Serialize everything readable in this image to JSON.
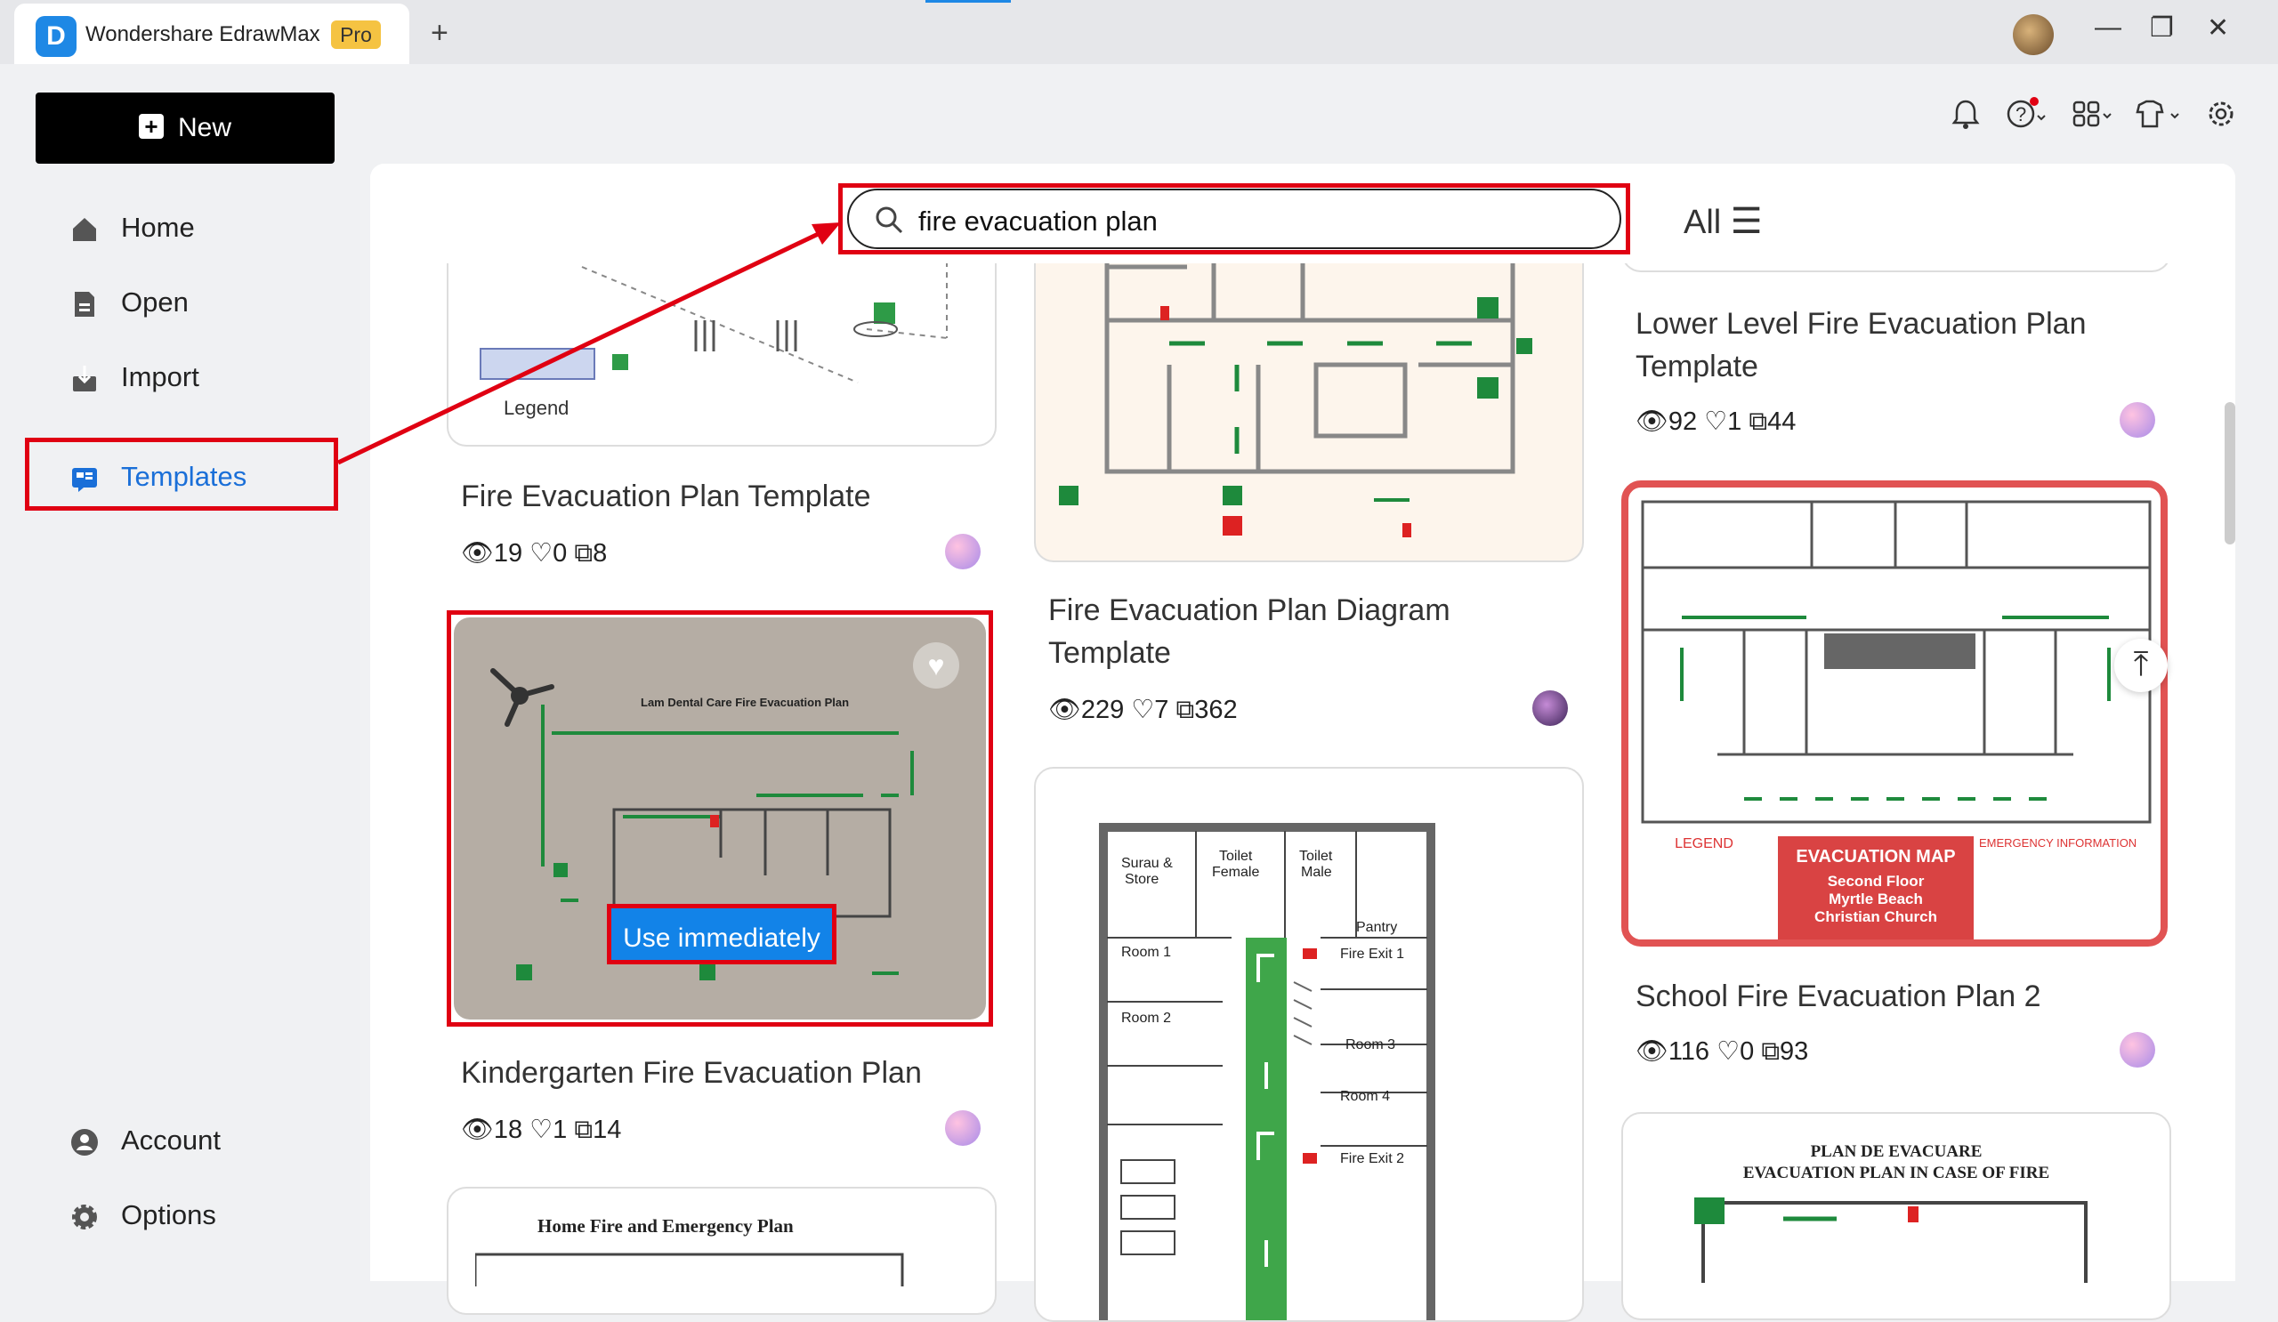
{
  "app": {
    "name": "Wondershare EdrawMax",
    "badge": "Pro",
    "new_tab": "+"
  },
  "window_controls": {
    "minimize": "—",
    "restore": "❐",
    "close": "✕"
  },
  "toolbar": {
    "notifications_icon": "bell-icon",
    "help_icon": "help-icon",
    "apps_icon": "apps-grid-icon",
    "theme_icon": "shirt-icon",
    "settings_icon": "gear-icon"
  },
  "sidebar": {
    "new_label": "New",
    "items": [
      {
        "label": "Home",
        "icon": "home-icon"
      },
      {
        "label": "Open",
        "icon": "file-icon"
      },
      {
        "label": "Import",
        "icon": "import-icon"
      },
      {
        "label": "Templates",
        "icon": "templates-icon",
        "active": true
      }
    ],
    "bottom_items": [
      {
        "label": "Account",
        "icon": "account-icon"
      },
      {
        "label": "Options",
        "icon": "gear-icon"
      }
    ]
  },
  "search": {
    "value": "fire evacuation plan",
    "filter_label": "All"
  },
  "accent_color": "#1283e8",
  "highlight_color": "#e00012",
  "templates": [
    {
      "title": "Fire Evacuation Plan Template",
      "views": "19",
      "likes": "0",
      "copies": "8",
      "preview_text": [
        "Legend"
      ]
    },
    {
      "title": "Kindergarten Fire Evacuation Plan",
      "views": "18",
      "likes": "1",
      "copies": "14",
      "preview_text": [
        "Lam Dental Care Fire Evacuation Plan"
      ],
      "hover_action": "Use immediately"
    },
    {
      "title": "Home Fire and Emergency Plan",
      "preview_text": [
        "Home Fire and Emergency Plan"
      ]
    },
    {
      "title": "Fire Evacuation Plan Diagram Template",
      "views": "229",
      "likes": "7",
      "copies": "362"
    },
    {
      "title": "",
      "preview_text": [
        "Surau &",
        "Store",
        "Toilet",
        "Female",
        "Toilet",
        "Male",
        "Pantry",
        "Fire Exit 1",
        "Room 1",
        "Room 2",
        "Room 3",
        "Room 4",
        "Fire Exit 2"
      ]
    },
    {
      "title": "Lower Level Fire Evacuation Plan Template",
      "views": "92",
      "likes": "1",
      "copies": "44"
    },
    {
      "title": "School Fire Evacuation Plan 2",
      "views": "116",
      "likes": "0",
      "copies": "93",
      "preview_text": [
        "LEGEND",
        "EVACUATION  MAP",
        "Second Floor",
        "Myrtle Beach",
        "Christian Church",
        "EMERGENCY INFORMATION"
      ]
    },
    {
      "title": "",
      "preview_text": [
        "PLAN DE  EVACUARE",
        "EVACUATION PLAN IN CASE OF FIRE"
      ]
    }
  ]
}
